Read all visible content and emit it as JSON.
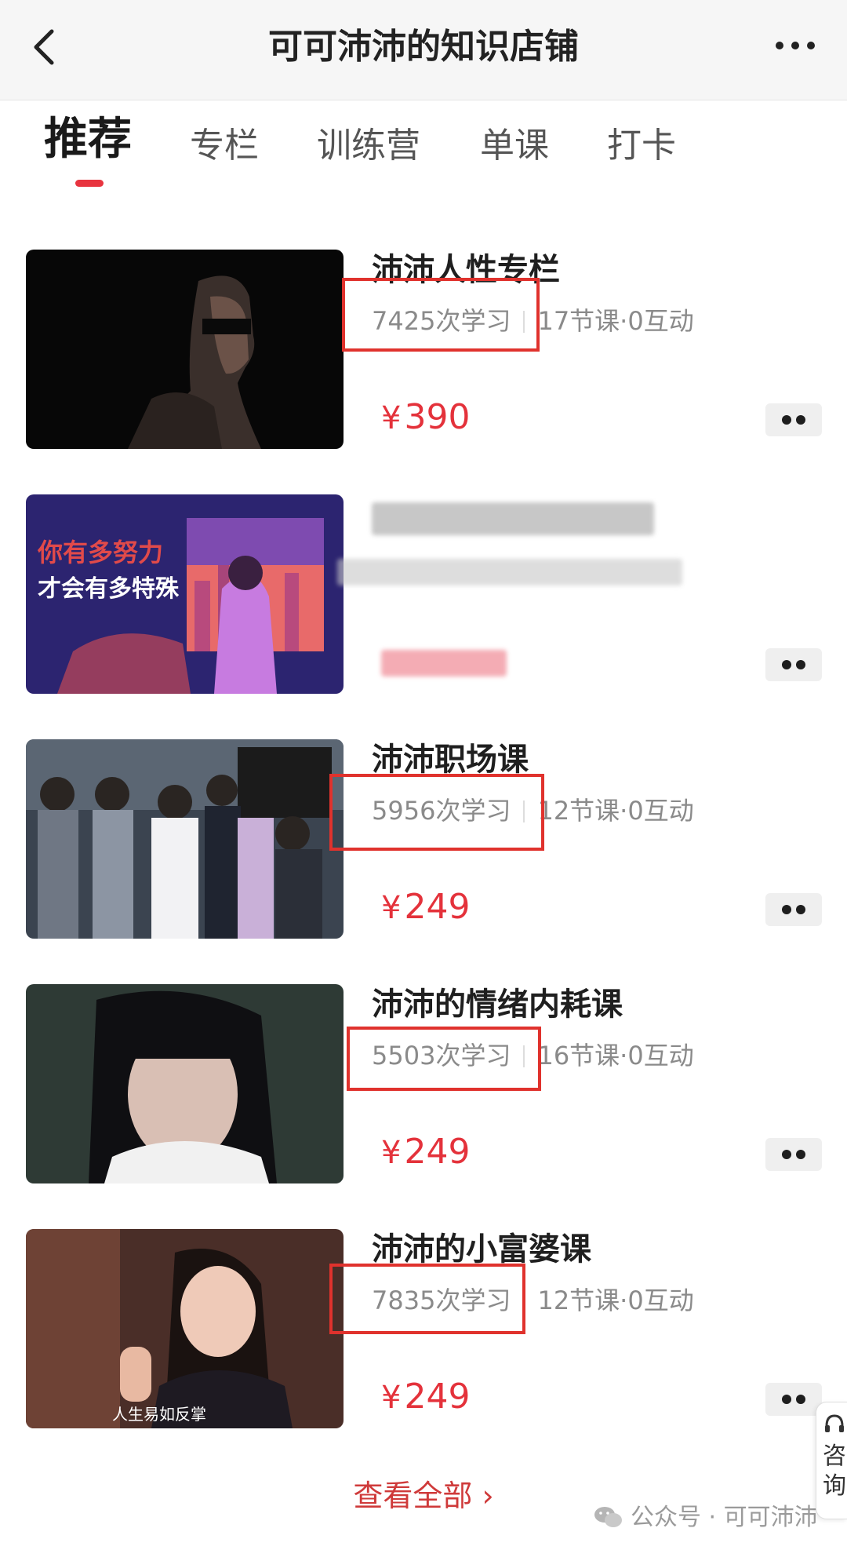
{
  "header": {
    "title": "可可沛沛的知识店铺",
    "back_icon": "chevron-left-icon",
    "more_icon": "more-dots-icon"
  },
  "tabs": [
    {
      "label": "推荐",
      "active": true
    },
    {
      "label": "专栏"
    },
    {
      "label": "训练营"
    },
    {
      "label": "单课"
    },
    {
      "label": "打卡"
    }
  ],
  "courses": [
    {
      "title": "沛沛人性专栏",
      "learners": "7425次学习",
      "detail": "17节课·0互动",
      "price": "390",
      "currency": "¥",
      "highlighted": true
    },
    {
      "title": "",
      "learners": "",
      "detail": "",
      "price": "",
      "currency": "",
      "blurred": true,
      "thumb_text_1": "你有多努力",
      "thumb_text_2": "才会有多特殊"
    },
    {
      "title": "沛沛职场课",
      "learners": "5956次学习",
      "detail": "12节课·0互动",
      "price": "249",
      "currency": "¥",
      "highlighted": true
    },
    {
      "title": "沛沛的情绪内耗课",
      "learners": "5503次学习",
      "detail": "16节课·0互动",
      "price": "249",
      "currency": "¥",
      "highlighted": true
    },
    {
      "title": "沛沛的小富婆课",
      "learners": "7835次学习",
      "detail": "12节课·0互动",
      "price": "249",
      "currency": "¥",
      "highlighted": true,
      "thumb_caption": "人生易如反掌"
    }
  ],
  "footer": {
    "view_all": "查看全部 ›"
  },
  "watermark": {
    "text": "公众号 · 可可沛沛"
  },
  "consult": {
    "label": "咨询"
  },
  "colors": {
    "accent_red": "#e4323b",
    "highlight_box": "#e0322d",
    "topbar_bg": "#f6f6f6"
  }
}
